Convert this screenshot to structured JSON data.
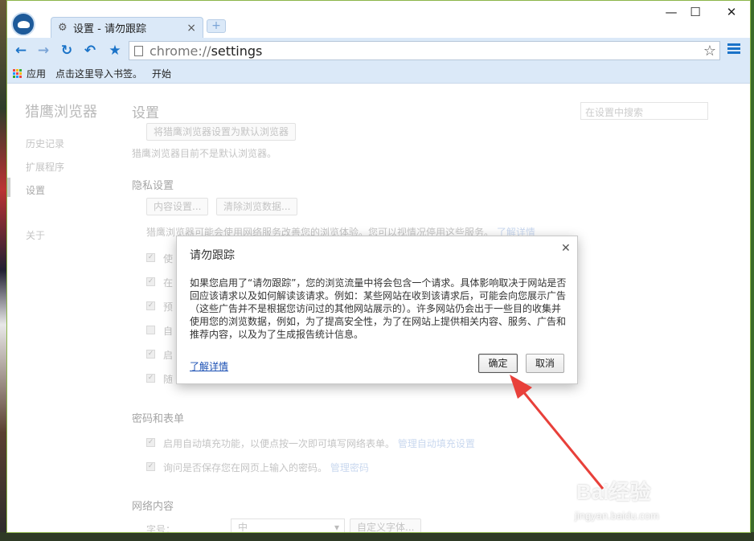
{
  "window": {
    "tab_title": "设置 - 请勿跟踪",
    "tab_icon": "gear-icon",
    "min_glyph": "—",
    "max_glyph": "☐",
    "close_glyph": "✕"
  },
  "toolbar": {
    "url_scheme": "chrome://",
    "url_path": "settings"
  },
  "bookmarks": {
    "apps_label": "应用",
    "import_label": "点击这里导入书签。",
    "start_label": "开始"
  },
  "sidebar": {
    "brand": "猎鹰浏览器",
    "items": [
      {
        "label": "历史记录"
      },
      {
        "label": "扩展程序"
      },
      {
        "label": "设置"
      },
      {
        "label": "关于"
      }
    ]
  },
  "settings": {
    "title": "设置",
    "search_placeholder": "在设置中搜索",
    "default_browser_button": "将猎鹰浏览器设置为默认浏览器",
    "default_browser_status": "猎鹰浏览器目前不是默认浏览器。",
    "privacy_heading": "隐私设置",
    "content_settings_button": "内容设置...",
    "clear_data_button": "清除浏览数据...",
    "privacy_note": "猎鹰浏览器可能会使用网络服务改善您的浏览体验。您可以视情况停用这些服务。",
    "privacy_learn_more": "了解详情",
    "privacy_items": [
      "使",
      "在",
      "预",
      "自",
      "启",
      "随"
    ],
    "passwords_heading": "密码和表单",
    "autofill_label": "启用自动填充功能，以便点按一次即可填写网络表单。",
    "autofill_link": "管理自动填充设置",
    "password_label": "询问是否保存您在网页上输入的密码。",
    "password_link": "管理密码",
    "web_content_heading": "网络内容",
    "font_size_label": "字号：",
    "font_size_value": "中",
    "custom_fonts_button": "自定义字体..."
  },
  "dialog": {
    "title": "请勿跟踪",
    "body": "如果您启用了“请勿跟踪”，您的浏览流量中将会包含一个请求。具体影响取决于网站是否回应该请求以及如何解读该请求。例如：某些网站在收到该请求后，可能会向您展示广告（这些广告并不是根据您访问过的其他网站展示的）。许多网站仍会出于一些目的收集并使用您的浏览数据，例如，为了提高安全性，为了在网站上提供相关内容、服务、广告和推荐内容，以及为了生成报告统计信息。",
    "learn_more": "了解详情",
    "confirm": "确定",
    "cancel": "取消"
  },
  "watermark": {
    "brand": "Bai经验",
    "sub": "jingyan.baidu.com"
  },
  "colors": {
    "accent": "#1a73c8",
    "annotation_arrow": "#e8403a"
  }
}
